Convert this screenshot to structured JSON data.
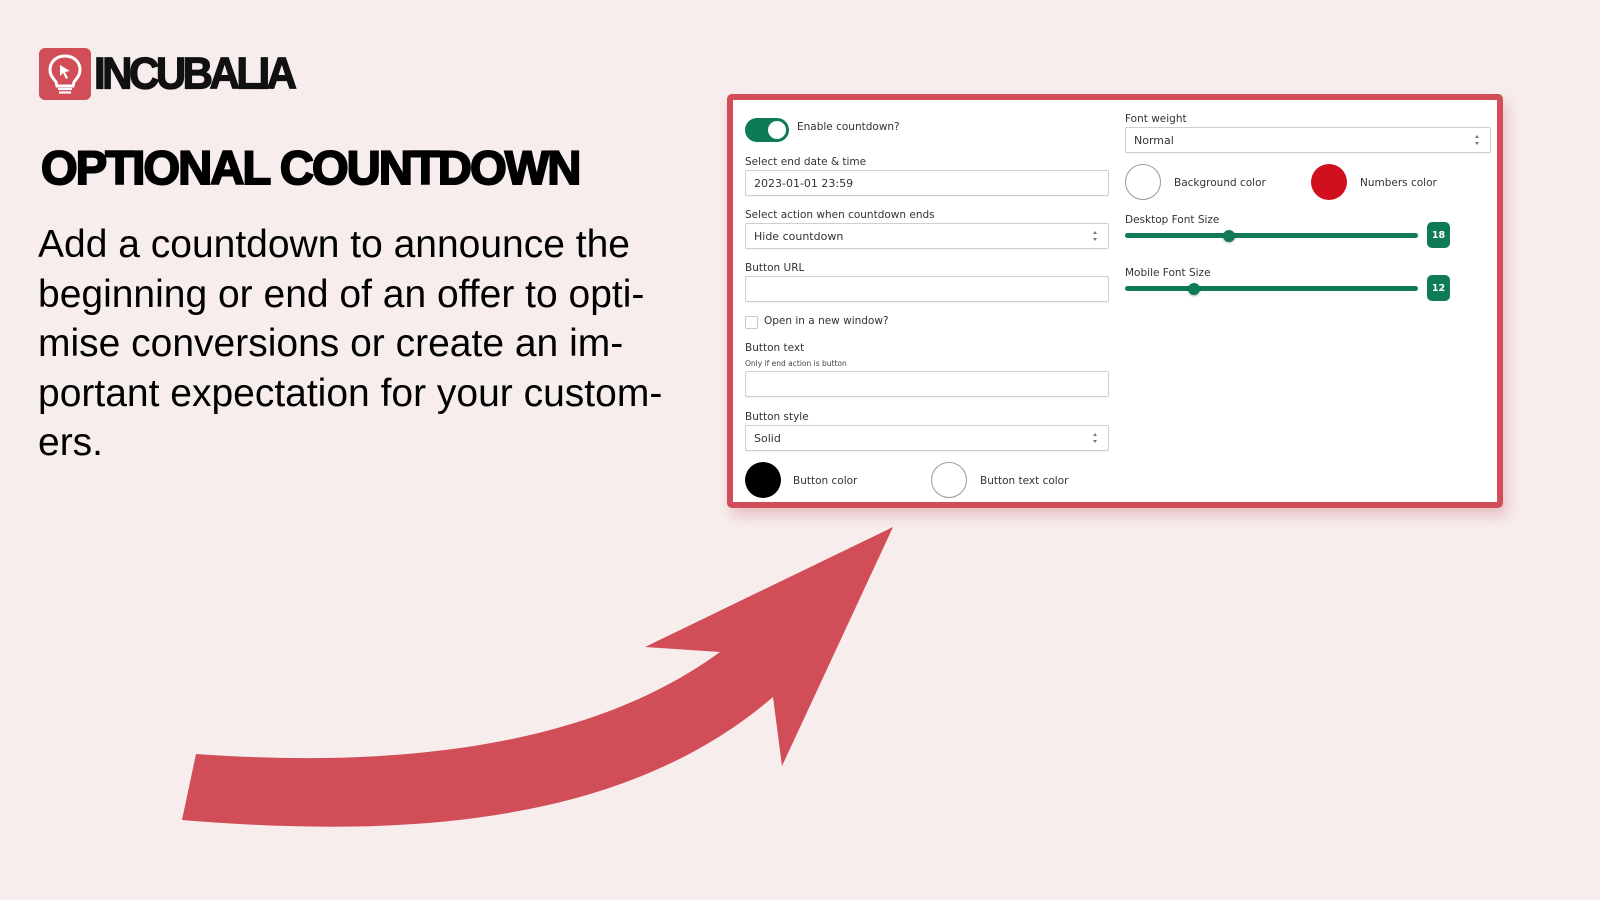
{
  "brand": {
    "name": "INCUBALIA",
    "logo_icon": "lightbulb-cursor-icon",
    "accent_color": "#d14d58"
  },
  "heading": "OPTIONAL COUNTDOWN",
  "description_lines": [
    "Add a countdown to announce the",
    "beginning or end of an offer to opti-",
    "mise conversions or create an im-",
    "portant expectation for your custom-",
    "ers."
  ],
  "decoration": {
    "arrow_icon": "curved-arrow-icon",
    "arrow_color": "#d14d58"
  },
  "settings_panel": {
    "enable_countdown": {
      "label": "Enable countdown?",
      "checked": true,
      "color": "#0f7a56"
    },
    "end_datetime": {
      "label": "Select end date & time",
      "value": "2023-01-01 23:59"
    },
    "end_action": {
      "label": "Select action when countdown ends",
      "value": "Hide countdown"
    },
    "button_url": {
      "label": "Button URL",
      "value": ""
    },
    "open_new_window": {
      "label": "Open in a new window?",
      "checked": false
    },
    "button_text": {
      "label": "Button text",
      "hint": "Only if end action is button",
      "value": ""
    },
    "button_style": {
      "label": "Button style",
      "value": "Solid"
    },
    "button_color": {
      "label": "Button color",
      "value": "#000000"
    },
    "button_text_color": {
      "label": "Button text color",
      "value": "#ffffff"
    },
    "font_weight": {
      "label": "Font weight",
      "value": "Normal"
    },
    "background_color": {
      "label": "Background color",
      "value": "#ffffff"
    },
    "numbers_color": {
      "label": "Numbers color",
      "value": "#d0101e"
    },
    "desktop_font_size": {
      "label": "Desktop Font Size",
      "value": "18",
      "fraction": 0.355
    },
    "mobile_font_size": {
      "label": "Mobile Font Size",
      "value": "12",
      "fraction": 0.235
    }
  }
}
